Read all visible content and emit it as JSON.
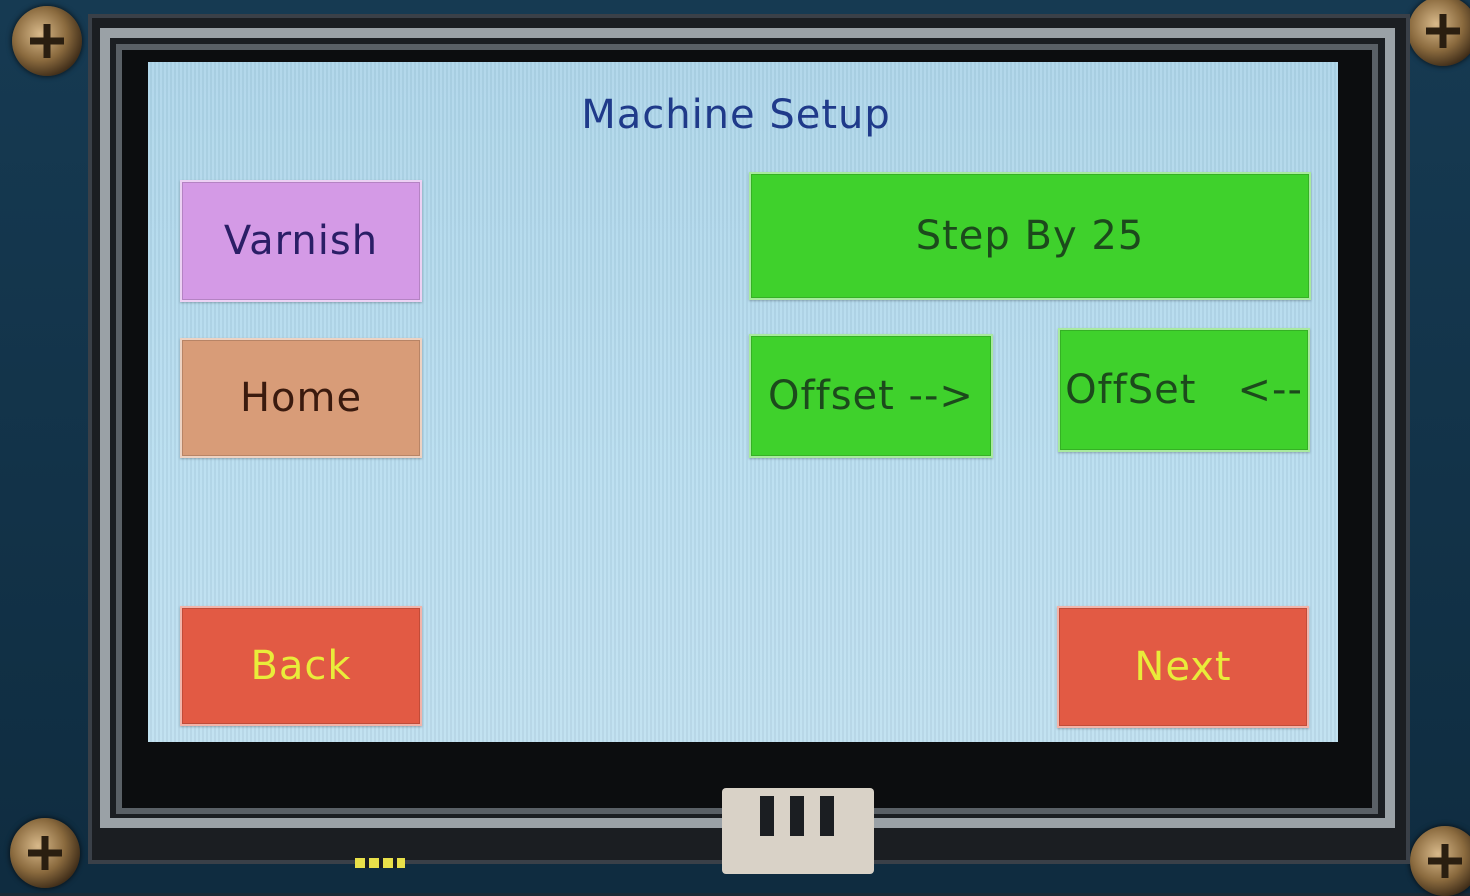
{
  "screen": {
    "title": "Machine Setup"
  },
  "buttons": {
    "varnish": "Varnish",
    "home": "Home",
    "back": "Back",
    "step": "Step By 25",
    "offset_right": "Offset -->",
    "offset_left": "OffSet   <--",
    "next": "Next"
  },
  "colors": {
    "screen_background": "#b9def0",
    "title_text": "#1f3a8a",
    "varnish_button": "#d49ae6",
    "home_button": "#d89c78",
    "nav_button": "#e25a44",
    "nav_button_text": "#e9ec3a",
    "action_button": "#3fd12c"
  }
}
